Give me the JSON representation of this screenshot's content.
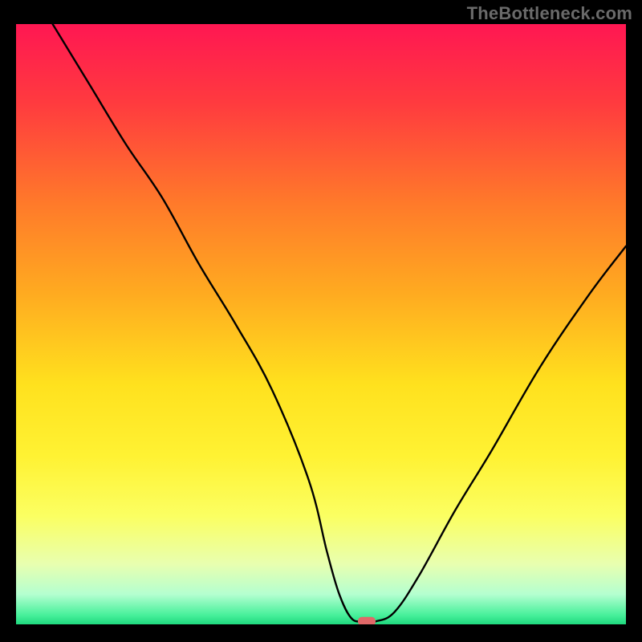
{
  "attribution": "TheBottleneck.com",
  "chart_data": {
    "type": "line",
    "title": "",
    "xlabel": "",
    "ylabel": "",
    "xlim": [
      0,
      100
    ],
    "ylim": [
      0,
      100
    ],
    "grid": false,
    "legend": false,
    "series": [
      {
        "name": "bottleneck-curve",
        "x": [
          6,
          12,
          18,
          24,
          30,
          36,
          42,
          48,
          51,
          53,
          55,
          57,
          59,
          62,
          66,
          72,
          78,
          86,
          94,
          100
        ],
        "y": [
          100,
          90,
          80,
          71,
          60,
          50,
          39,
          24,
          12,
          5,
          1,
          0.5,
          0.5,
          2,
          8,
          19,
          29,
          43,
          55,
          63
        ]
      }
    ],
    "marker": {
      "x": 57.5,
      "y": 0.5,
      "shape": "rounded-rect"
    },
    "background_gradient": {
      "stops": [
        {
          "offset": 0.0,
          "color": "#ff1752"
        },
        {
          "offset": 0.13,
          "color": "#ff3a3f"
        },
        {
          "offset": 0.3,
          "color": "#ff7a2a"
        },
        {
          "offset": 0.45,
          "color": "#ffab20"
        },
        {
          "offset": 0.6,
          "color": "#ffe11e"
        },
        {
          "offset": 0.72,
          "color": "#fff233"
        },
        {
          "offset": 0.82,
          "color": "#fbff62"
        },
        {
          "offset": 0.9,
          "color": "#e8ffb0"
        },
        {
          "offset": 0.95,
          "color": "#b4ffd0"
        },
        {
          "offset": 0.985,
          "color": "#46f09a"
        },
        {
          "offset": 1.0,
          "color": "#1fd97e"
        }
      ]
    }
  }
}
